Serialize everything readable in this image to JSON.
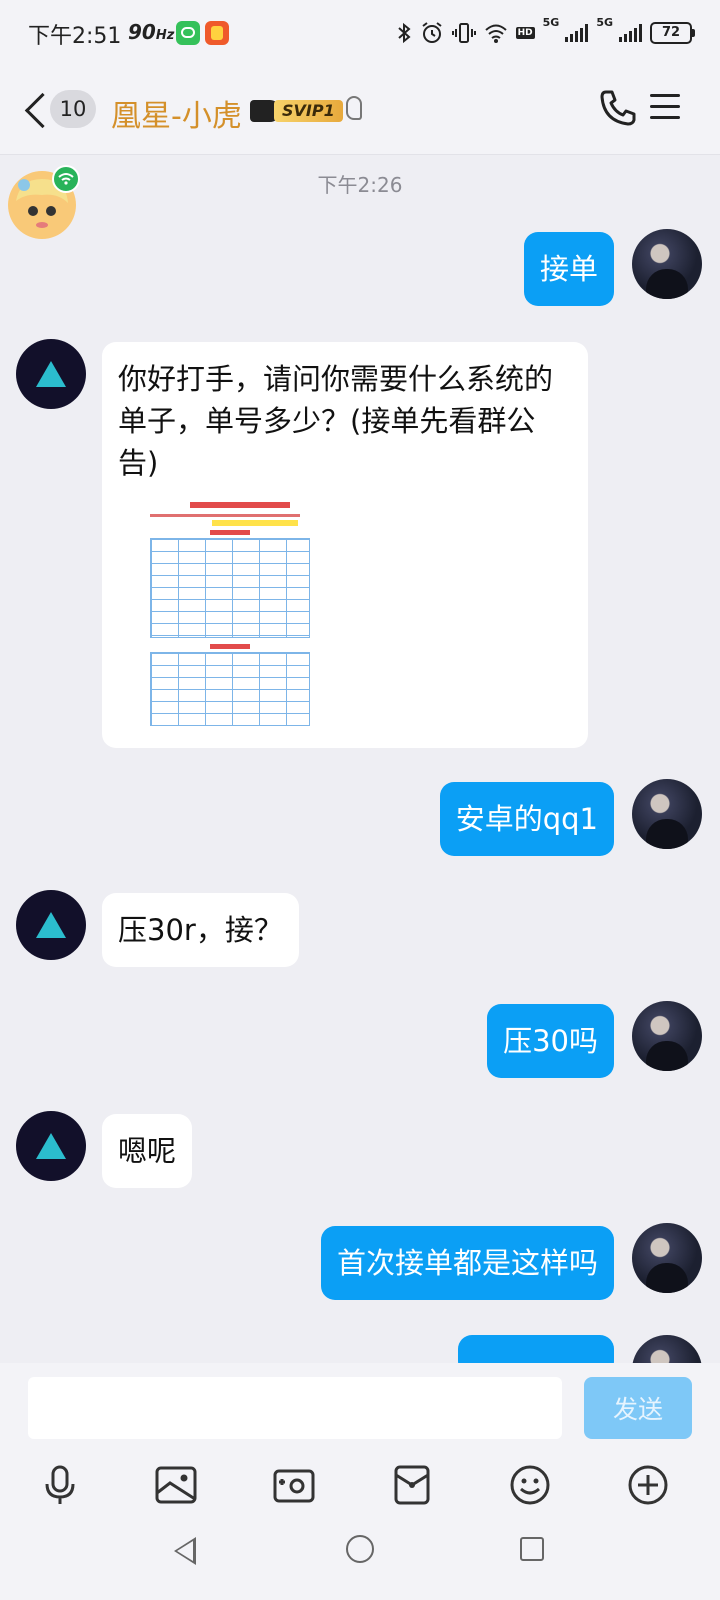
{
  "status_bar": {
    "time": "下午2:51",
    "refresh_rate": "90",
    "refresh_unit": "Hz",
    "network": "5G",
    "hd_badge": "HD",
    "battery": "72"
  },
  "header": {
    "unread_count": "10",
    "title": "凰星-小虎",
    "vip_badge": "SVIP1",
    "title_color": "#d4902a"
  },
  "chat": {
    "timestamp": "下午2:26",
    "messages": [
      {
        "from": "me",
        "text": "接单"
      },
      {
        "from": "them",
        "text": "你好打手，请问你需要什么系统的单子，单号多少？(接单先看群公告)",
        "has_image": true
      },
      {
        "from": "me",
        "text": "安卓的qq1"
      },
      {
        "from": "them",
        "text": "压30r，接？"
      },
      {
        "from": "me",
        "text": "压30吗"
      },
      {
        "from": "them",
        "text": "嗯呢"
      },
      {
        "from": "me",
        "text": "首次接单都是这样吗"
      }
    ],
    "image_caption": "凰星电竞王者荣耀代打单子",
    "image_section_1": "安卓系统区",
    "image_section_2": "苹果系统区",
    "bubble_color_me": "#0b9ff5"
  },
  "composer": {
    "input_value": "",
    "send_label": "发送",
    "tool_icons": [
      "microphone-icon",
      "image-icon",
      "camera-icon",
      "red-packet-icon",
      "emoji-icon",
      "plus-icon"
    ]
  }
}
